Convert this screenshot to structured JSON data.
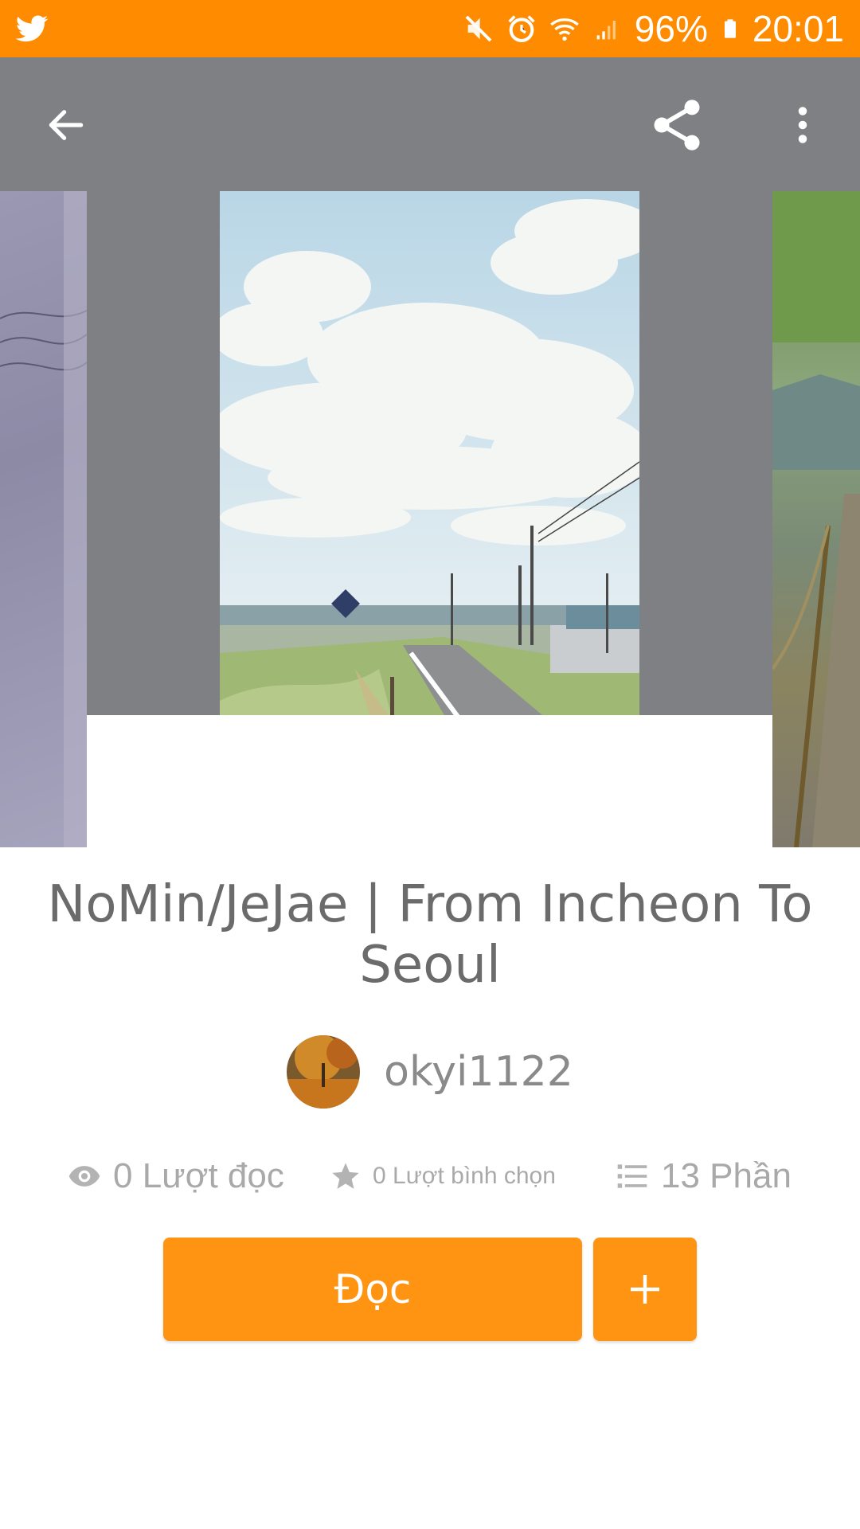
{
  "status_bar": {
    "battery": "96%",
    "time": "20:01",
    "icons": [
      "twitter-icon",
      "mute-icon",
      "alarm-icon",
      "wifi-icon",
      "signal-icon",
      "battery-icon"
    ]
  },
  "toolbar": {
    "icons": [
      "back-arrow-icon",
      "share-icon",
      "more-vertical-icon"
    ]
  },
  "story": {
    "title": "NoMin/JeJae | From Incheon To Seoul",
    "author": "okyi1122"
  },
  "stats": {
    "reads": "0 Lượt đọc",
    "votes": "0 Lượt bình chọn",
    "parts": "13 Phần",
    "icons": [
      "eye-icon",
      "star-icon",
      "list-icon"
    ]
  },
  "actions": {
    "read_label": "Đọc",
    "add_label": "+"
  },
  "colors": {
    "accent": "#ff8c00",
    "button": "#ff9412",
    "header_bg": "#7e8083",
    "title_text": "#6b6b6b",
    "stat_text": "#a9a9a9"
  }
}
